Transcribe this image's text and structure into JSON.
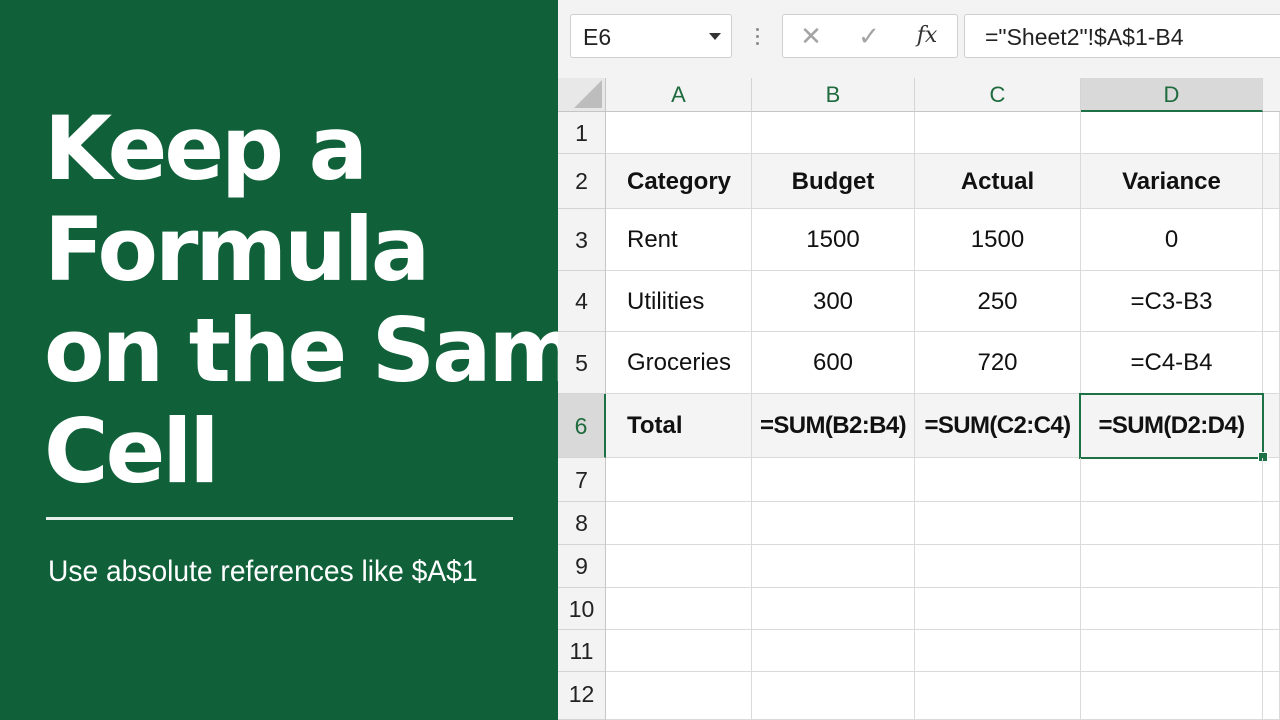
{
  "promo": {
    "title_lines": [
      "Keep a",
      "Formula",
      "on the Same",
      "Cell"
    ],
    "subtitle": "Use absolute references like $A$1"
  },
  "toolbar": {
    "name_box": "E6",
    "cancel_symbol": "✕",
    "enter_symbol": "✓",
    "fx_label": "fx",
    "formula": "=\"Sheet2\"!$A$1-B4"
  },
  "sheet": {
    "columns": [
      "A",
      "B",
      "C",
      "D"
    ],
    "active_column": "D",
    "rows": [
      "1",
      "2",
      "3",
      "4",
      "5",
      "6",
      "7",
      "8",
      "9",
      "10",
      "11",
      "12"
    ],
    "active_row": "6",
    "cells": {
      "A2": "Category",
      "B2": "Budget",
      "C2": "Actual",
      "D2": "Variance",
      "A3": "Rent",
      "B3": "1500",
      "C3": "1500",
      "D3": "0",
      "A4": "Utilities",
      "B4": "300",
      "C4": "250",
      "D4": "=C3-B3",
      "A5": "Groceries",
      "B5": "600",
      "C5": "720",
      "D5": "=C4-B4",
      "A6": "Total",
      "B6": "=SUM(B2:B4)",
      "C6": "=SUM(C2:C4)",
      "D6": "=SUM(D2:D4)"
    }
  },
  "colors": {
    "brand_green": "#10613A",
    "selection_green": "#1e7145"
  }
}
